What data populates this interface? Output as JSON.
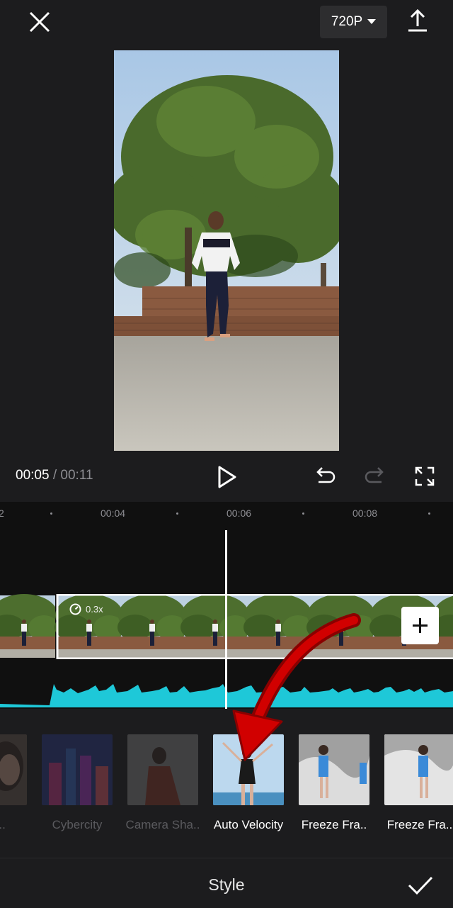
{
  "toolbar": {
    "resolution_label": "720P"
  },
  "playback": {
    "current_time": "00:05",
    "separator": "/",
    "total_time": "00:11"
  },
  "timeline": {
    "ruler": [
      {
        "label": "2"
      },
      {
        "label": "00:04"
      },
      {
        "label": "00:06"
      },
      {
        "label": "00:08"
      }
    ],
    "clip_speed": "0.3x"
  },
  "styles": {
    "items": [
      {
        "label": "Bou..",
        "selected": false
      },
      {
        "label": "Cybercity",
        "selected": false
      },
      {
        "label": "Camera Sha..",
        "selected": false
      },
      {
        "label": "Auto Velocity",
        "selected": true
      },
      {
        "label": "Freeze Fra..",
        "selected": false
      },
      {
        "label": "Freeze Fra..",
        "selected": false
      }
    ]
  },
  "panel": {
    "title": "Style"
  },
  "colors": {
    "background": "#1c1c1e",
    "waveform": "#1ec8d8",
    "annotation_arrow": "#d10000"
  }
}
